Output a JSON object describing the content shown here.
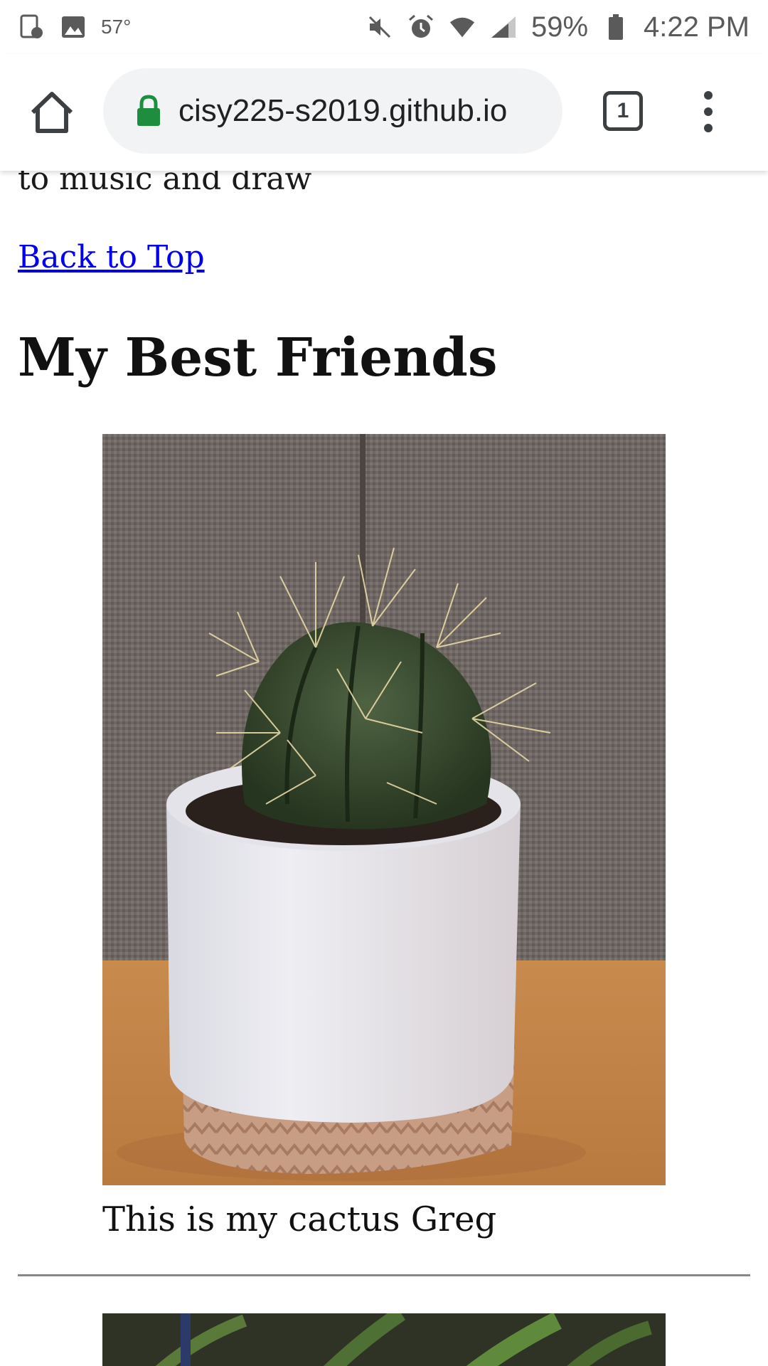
{
  "status_bar": {
    "temperature": "57°",
    "battery": "59%",
    "time": "4:22 PM"
  },
  "browser": {
    "url": "cisy225-s2019.github.io",
    "tab_count": "1"
  },
  "page": {
    "partial_text": "to music and draw",
    "back_link": "Back to Top",
    "section_title": "My Best Friends",
    "photo_caption": "This is my cactus Greg"
  },
  "colors": {
    "link": "#0000ee",
    "lock": "#1e8e3e",
    "url_pill": "#f1f3f4"
  }
}
